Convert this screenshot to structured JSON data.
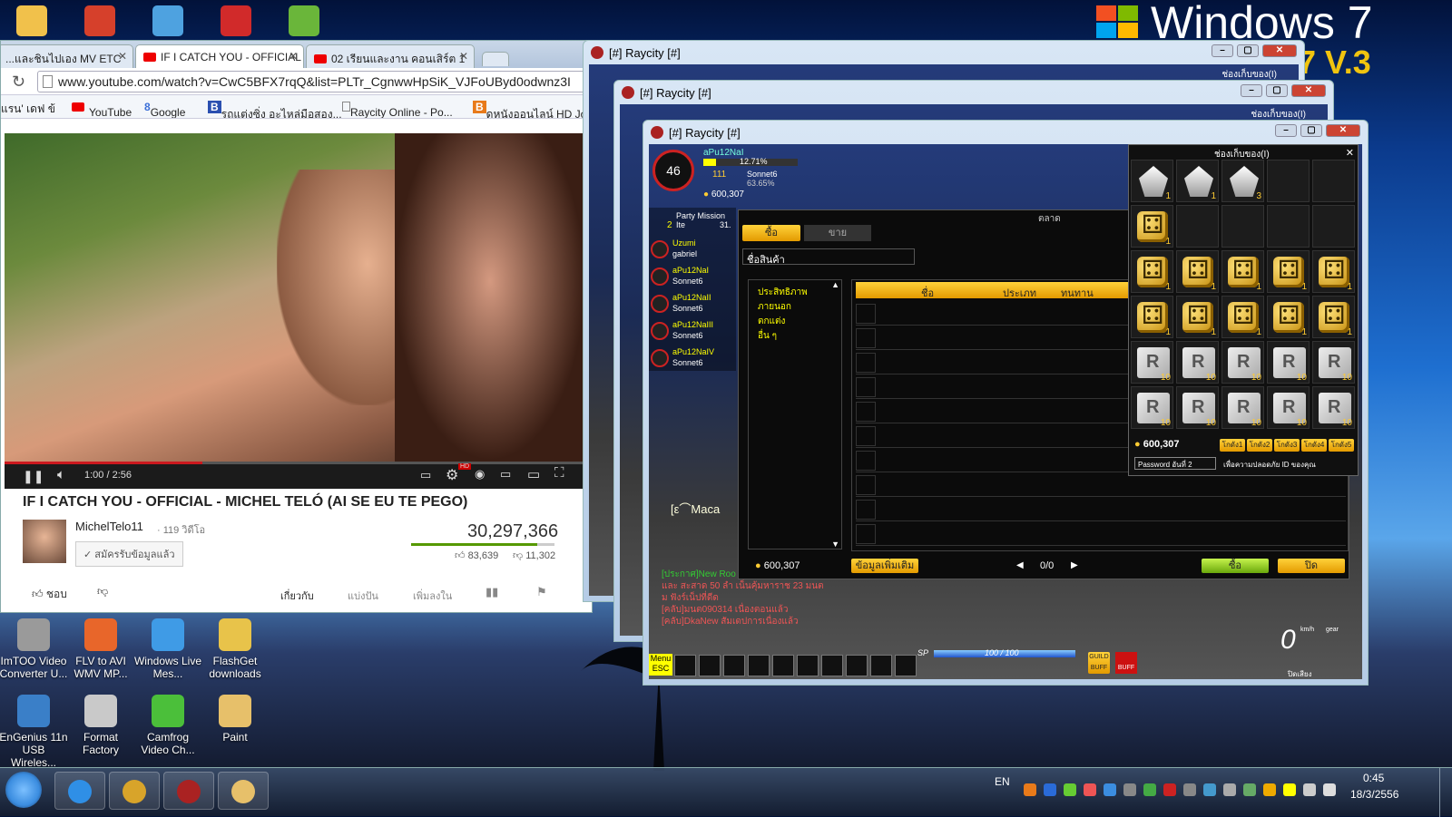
{
  "desktop": {
    "brand_title": "Windows 7",
    "brand_version": "7 V.3",
    "icons": [
      {
        "label": "ImTOO Video Converter U...",
        "icon": "imtoo-icon",
        "color": "#9a9a9a"
      },
      {
        "label": "FLV to AVI WMV MP...",
        "icon": "flv-converter-icon",
        "color": "#e8662a"
      },
      {
        "label": "Windows Live Mes...",
        "icon": "messenger-icon",
        "color": "#3f9be6"
      },
      {
        "label": "FlashGet downloads",
        "icon": "folder-icon",
        "color": "#e8c34a"
      },
      {
        "label": "EnGenius 11n USB Wireles...",
        "icon": "engenius-icon",
        "color": "#3a7fc8"
      },
      {
        "label": "Format Factory",
        "icon": "format-factory-icon",
        "color": "#c9c9c9"
      },
      {
        "label": "Camfrog Video Ch...",
        "icon": "camfrog-icon",
        "color": "#4bbf3a"
      },
      {
        "label": "Paint",
        "icon": "paint-icon",
        "color": "#e7c06a"
      }
    ],
    "top_icons": [
      {
        "icon": "folder-icon",
        "color": "#f1c14b"
      },
      {
        "icon": "cleaner-icon",
        "color": "#d6402b"
      },
      {
        "icon": "notepad-icon",
        "color": "#4ea2e0"
      },
      {
        "icon": "angry-birds-icon",
        "color": "#d12a2a"
      },
      {
        "icon": "bluestacks-icon",
        "color": "#6ab63a"
      }
    ]
  },
  "browser": {
    "tabs": [
      {
        "label": "...และชินไปเอง MV ETC",
        "active": false
      },
      {
        "label": "IF I CATCH YOU - OFFICIAL",
        "active": true
      },
      {
        "label": "02 เรียนและงาน คอนเสิร์ต 1",
        "active": false
      }
    ],
    "url": "www.youtube.com/watch?v=CwC5BFX7rqQ&list=PLTr_CgnwwHpSiK_VJFoUByd0odwnz3I",
    "bookmarks": [
      "แรน' เดฟ ข้",
      "YouTube",
      "Google",
      "รถแต่งซิ่ง อะไหล่มือสอง...",
      "Raycity Online - Po...",
      "ดูหนังออนไลน์ HD Jo"
    ],
    "player": {
      "time": "1:00 / 2:56",
      "progress": 0.34,
      "hd_badge": "HD"
    },
    "video_title": "IF I CATCH YOU - OFFICIAL - MICHEL TELÓ (AI SE EU TE PEGO)",
    "channel_name": "MichelTelo11",
    "channel_videos": "· 119 วิดีโอ",
    "subscribe_label": "✓ สมัครรับข้อมูลแล้ว",
    "view_count": "30,297,366",
    "likes": "83,639",
    "dislikes": "11,302",
    "like_ratio": 0.88,
    "like_label": "ชอบ",
    "action_tabs": [
      "เกี่ยวกับ",
      "แบ่งปัน",
      "เพิ่มลงใน"
    ]
  },
  "game": {
    "window_title": "[#] Raycity [#]",
    "storage_title": "ช่องเก็บของ(I)",
    "player": {
      "level": "46",
      "exp": "12.71%",
      "name": "aPu12NaI",
      "car_level": "111",
      "car_name": "Sonnet6",
      "car_exp": "63.65%",
      "money": "600,307"
    },
    "party_title": "Party Mission Ite",
    "party_level": "2",
    "party_percent": "31.",
    "party_members": [
      {
        "name": "Uzumi",
        "car": "gabriel"
      },
      {
        "name": "aPu12NaI",
        "car": "Sonnet6"
      },
      {
        "name": "aPu12NaII",
        "car": "Sonnet6"
      },
      {
        "name": "aPu12NaIII",
        "car": "Sonnet6"
      },
      {
        "name": "aPu12NaIV",
        "car": "Sonnet6"
      }
    ],
    "shop": {
      "title": "ตลาด",
      "tab_buy": "ซื้อ",
      "tab_sell": "ขาย",
      "search_label": "ชื่อสินค้า",
      "categories": [
        "ประสิทธิภาพ",
        "ภายนอก",
        "ตกแต่ง",
        "อื่น ๆ"
      ],
      "columns": [
        "ชื่อ",
        "ประเภท",
        "ทนทาน"
      ],
      "money": "600,307",
      "more_info_label": "ข้อมูลเพิ่มเติม",
      "page": "0/0",
      "buy_label": "ซื้อ",
      "close_label": "ปิด"
    },
    "inventory": {
      "money": "600,307",
      "tabs": [
        "โกดัง1",
        "โกดัง2",
        "โกดัง3",
        "โกดัง4",
        "โกดัง5"
      ],
      "password_label": "Password อันที่ 2",
      "password_hint": "เพื่อความปลอดภัย ID ของคุณ",
      "rows": [
        [
          {
            "type": "crown",
            "qty": "1"
          },
          {
            "type": "crown",
            "qty": "1"
          },
          {
            "type": "crown",
            "qty": "3"
          },
          {
            "type": "empty",
            "qty": ""
          },
          {
            "type": "empty",
            "qty": ""
          }
        ],
        [
          {
            "type": "dice",
            "qty": "1"
          },
          {
            "type": "empty",
            "qty": ""
          },
          {
            "type": "empty",
            "qty": ""
          },
          {
            "type": "empty",
            "qty": ""
          },
          {
            "type": "empty",
            "qty": ""
          }
        ],
        [
          {
            "type": "dice",
            "qty": "1"
          },
          {
            "type": "dice",
            "qty": "1"
          },
          {
            "type": "dice",
            "qty": "1"
          },
          {
            "type": "dice",
            "qty": "1"
          },
          {
            "type": "dice",
            "qty": "1"
          }
        ],
        [
          {
            "type": "dice",
            "qty": "1"
          },
          {
            "type": "dice",
            "qty": "1"
          },
          {
            "type": "dice",
            "qty": "1"
          },
          {
            "type": "dice",
            "qty": "1"
          },
          {
            "type": "dice",
            "qty": "1"
          }
        ],
        [
          {
            "type": "card",
            "qty": "10"
          },
          {
            "type": "card",
            "qty": "10"
          },
          {
            "type": "card",
            "qty": "10"
          },
          {
            "type": "card",
            "qty": "10"
          },
          {
            "type": "card",
            "qty": "10"
          }
        ],
        [
          {
            "type": "card",
            "qty": "10"
          },
          {
            "type": "card",
            "qty": "10"
          },
          {
            "type": "card",
            "qty": "10"
          },
          {
            "type": "card",
            "qty": "10"
          },
          {
            "type": "card",
            "qty": "10"
          }
        ]
      ]
    },
    "chat": {
      "npc_name": "[ε⌒Maca",
      "lines": [
        "[ประกาศ]New Roo",
        "และ สะสาด 50 ลำ เน็นคุ้มหาราช 23 มนต",
        "ม ฟังร์เน็ปที่ดีด",
        "[คลับ]มนต090314 เนื่องตอนแล้ว",
        "[คลับ]DkaNew สัมเดปการเนื่องแล้ว"
      ]
    },
    "hud": {
      "menu": "Menu",
      "esc": "ESC",
      "sp_label": "SP",
      "sp_value": "100 / 100",
      "speed": "0",
      "gear": "gear",
      "kmh": "km/h",
      "guild_buff": "GUILD BUFF",
      "buff": "BUFF",
      "sub_label": "ปิดเสียง"
    }
  },
  "taskbar": {
    "apps": [
      {
        "icon": "start-orb-icon",
        "color": "#3b8de0"
      },
      {
        "icon": "internet-explorer-icon",
        "color": "#2f8fe6"
      },
      {
        "icon": "chrome-icon",
        "color": "#d8a42a"
      },
      {
        "icon": "raycity-icon",
        "color": "#a22"
      },
      {
        "icon": "paint-icon",
        "color": "#e7c06a"
      }
    ],
    "language": "EN",
    "time": "0:45",
    "date": "18/3/2556"
  }
}
